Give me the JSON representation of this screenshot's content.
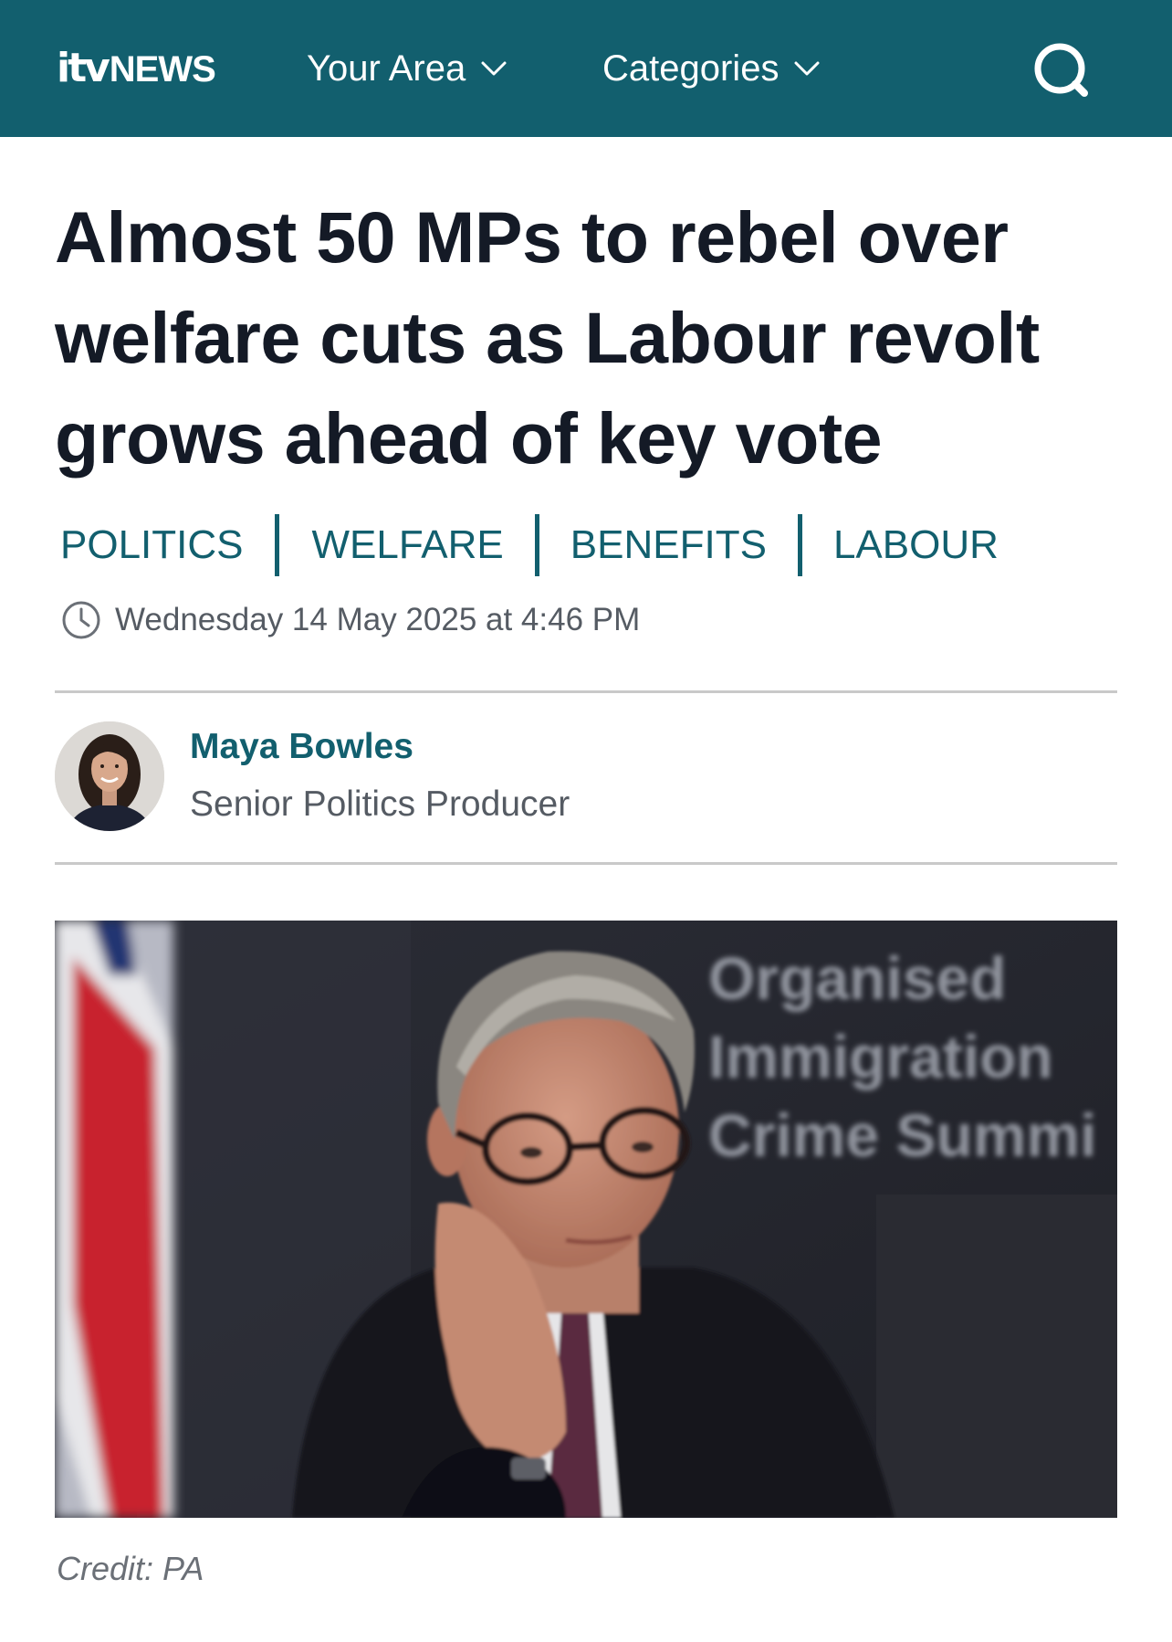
{
  "header": {
    "logo_itv": "itv",
    "logo_news": "NEWS",
    "nav": [
      {
        "label": "Your Area"
      },
      {
        "label": "Categories"
      }
    ],
    "background_color": "#125f6e"
  },
  "article": {
    "headline": "Almost 50 MPs to rebel over welfare cuts as Labour revolt grows ahead of key vote",
    "tags": [
      "POLITICS",
      "WELFARE",
      "BENEFITS",
      "LABOUR"
    ],
    "published": "Wednesday 14 May 2025 at 4:46 PM",
    "author": {
      "name": "Maya Bowles",
      "role": "Senior Politics Producer"
    },
    "image": {
      "backdrop_text": [
        "Organised",
        "Immigration",
        "Crime Summi"
      ],
      "credit": "Credit: PA"
    }
  },
  "icons": {
    "search": "search-icon",
    "chevron": "chevron-down-icon",
    "clock": "clock-icon"
  },
  "colors": {
    "accent": "#125f6e",
    "headline": "#141a26",
    "meta": "#555b63"
  }
}
